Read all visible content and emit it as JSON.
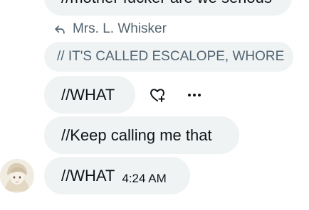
{
  "messages": {
    "top_partial": "//mother fucker are we serious",
    "reply_to_label": "Mrs. L. Whisker",
    "quoted_text": "// IT'S CALLED ESCALOPE, WHORE",
    "msg_what_1": "//WHAT",
    "msg_keep": "//Keep calling me that",
    "msg_what_2": "//WHAT",
    "msg_what_2_time": "4:24 AM"
  },
  "icons": {
    "reply_context": "reply-arrow-icon",
    "react": "heart-plus-icon",
    "more": "more-horizontal-icon",
    "avatar": "user-avatar-image"
  },
  "colors": {
    "bubble_bg": "#eff3f4",
    "primary_text": "#0f1419",
    "secondary_text": "#536471"
  }
}
